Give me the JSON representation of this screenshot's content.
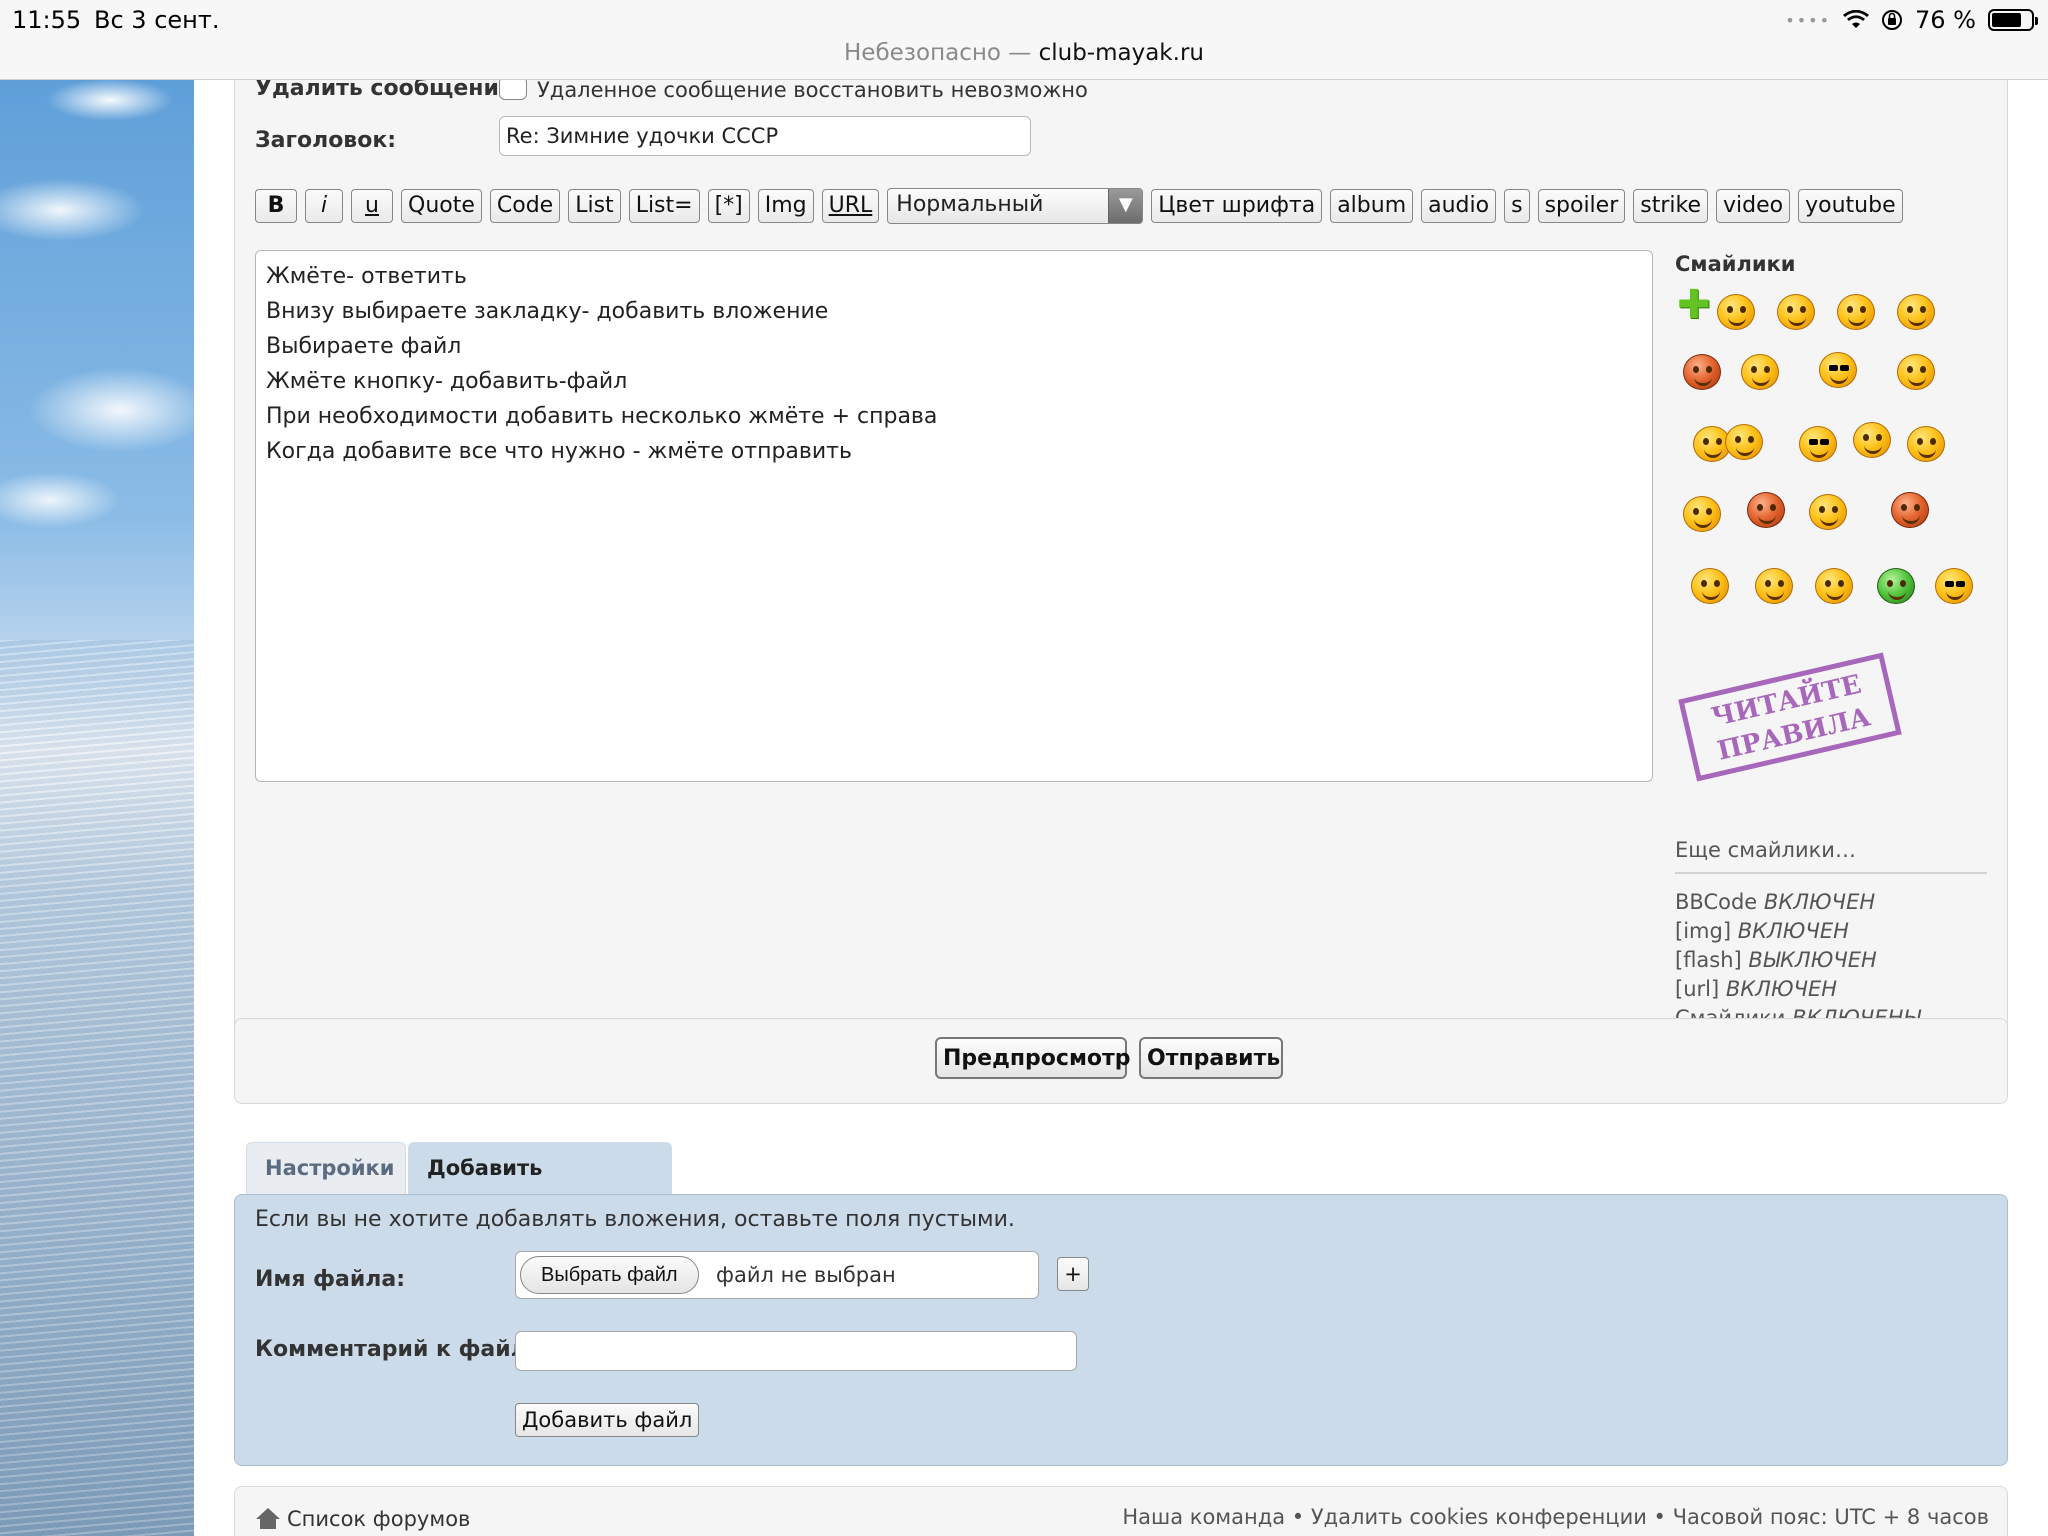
{
  "status_bar": {
    "time": "11:55",
    "date": "Вс 3 сент.",
    "battery": "76 %",
    "battery_level": 0.76,
    "url_prefix": "Небезопасно — ",
    "url_domain": "club-mayak.ru"
  },
  "form": {
    "delete_label": "Удалить сообщение:",
    "delete_note": "Удаленное сообщение восстановить невозможно",
    "subject_label": "Заголовок:",
    "subject_value": "Re: Зимние удочки СССР"
  },
  "toolbar": {
    "bold": "B",
    "italic": "i",
    "underline": "u",
    "quote": "Quote",
    "code": "Code",
    "list": "List",
    "list_ordered": "List=",
    "list_item": "[*]",
    "img": "Img",
    "url": "URL",
    "font_size_selected": "Нормальный",
    "font_color": "Цвет шрифта",
    "album": "album",
    "audio": "audio",
    "strike_short": "s",
    "spoiler": "spoiler",
    "strike": "strike",
    "video": "video",
    "youtube": "youtube"
  },
  "message": {
    "lines": [
      "Жмёте- ответить",
      "Внизу выбираете закладку- добавить вложение",
      "Выбираете файл",
      "Жмёте кнопку- добавить-файл",
      "При необходимости добавить несколько жмёте + справа",
      "Когда добавите все что нужно - жмёте отправить"
    ]
  },
  "smilies": {
    "title": "Смайлики",
    "stamp_lines": [
      "ЧИТАЙТЕ",
      "ПРАВИЛА"
    ],
    "more": "Еще смайлики…",
    "options": [
      {
        "name": "BBCode",
        "state": "ВКЛЮЧЕН"
      },
      {
        "name": "[img]",
        "state": "ВКЛЮЧЕН"
      },
      {
        "name": "[flash]",
        "state": "ВЫКЛЮЧЕН"
      },
      {
        "name": "[url]",
        "state": "ВКЛЮЧЕН"
      },
      {
        "name": "Смайлики",
        "state": "ВКЛЮЧЕНЫ"
      }
    ]
  },
  "actions": {
    "preview": "Предпросмотр",
    "submit": "Отправить"
  },
  "tabs": {
    "settings": "Настройки",
    "attachments": "Добавить вложения"
  },
  "attachments": {
    "hint": "Если вы не хотите добавлять вложения, оставьте поля пустыми.",
    "file_label": "Имя файла:",
    "choose_file": "Выбрать файл",
    "no_file": "файл не выбран",
    "add_more": "+",
    "comment_label": "Комментарий к файлу:",
    "add_file": "Добавить файл"
  },
  "footer": {
    "forum_list": "Список форумов",
    "links": "Наша команда • Удалить cookies конференции • Часовой пояс: UTC + 8 часов"
  }
}
